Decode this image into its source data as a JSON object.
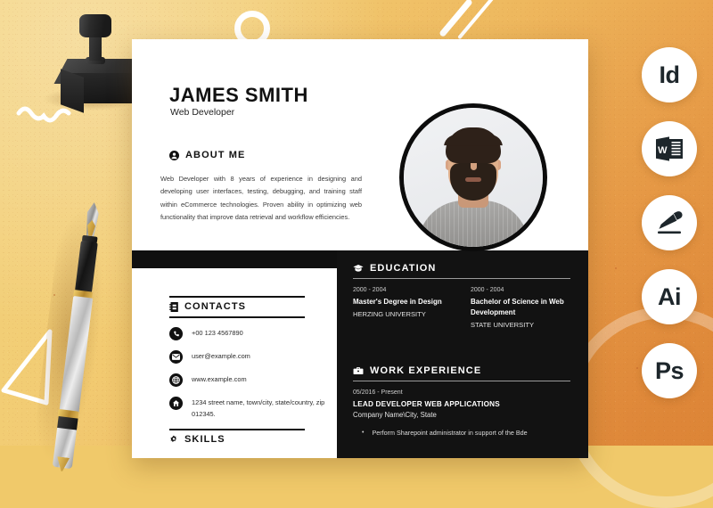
{
  "background": {
    "base_color": "#eeb85e",
    "page_color": "#ffffff",
    "accent_dark": "#101010"
  },
  "decor": {
    "stamp": "rubber-stamp",
    "pen": "fountain-pen",
    "ring": "white-ring-circle",
    "stripes": "white-diagonal-stripes",
    "squiggle": "white-squiggle",
    "triangle": "white-triangle-outline",
    "arc": "white-corner-arc"
  },
  "resume": {
    "name": "JAMES SMITH",
    "role": "Web Developer",
    "photo_alt": "portrait-photo",
    "about": {
      "icon": "user-icon",
      "title": "ABOUT ME",
      "text": "Web Developer with 8 years of experience in designing and developing user interfaces, testing, debugging, and training staff within eCommerce technologies. Proven ability in optimizing web functionality that improve data retrieval and workflow efficiencies."
    },
    "contacts": {
      "icon": "address-book-icon",
      "title": "CONTACTS",
      "items": [
        {
          "icon": "phone-icon",
          "text": "+00 123 4567890"
        },
        {
          "icon": "email-icon",
          "text": "user@example.com"
        },
        {
          "icon": "globe-icon",
          "text": "www.example.com"
        },
        {
          "icon": "home-icon",
          "text": "1234 street name, town/city, state/country, zip 012345."
        }
      ]
    },
    "skills": {
      "icon": "gear-icon",
      "title": "SKILLS"
    },
    "education": {
      "icon": "graduation-cap-icon",
      "title": "EDUCATION",
      "entries": [
        {
          "dates": "2000 - 2004",
          "degree": "Master's Degree in Design",
          "school": "HERZING UNIVERSITY"
        },
        {
          "dates": "2000 - 2004",
          "degree": "Bachelor of Science in Web Development",
          "school": "STATE UNIVERSITY"
        }
      ]
    },
    "work": {
      "icon": "briefcase-icon",
      "title": "WORK EXPERIENCE",
      "dates": "05/2016 - Present",
      "job_title": "LEAD DEVELOPER WEB APPLICATIONS",
      "company": "Company Name\\City, State",
      "bullet_marker": "•",
      "bullets": [
        "Perform Sharepoint administrator in support of the Bde"
      ]
    }
  },
  "badges": [
    {
      "id": "indesign",
      "label": "Id",
      "icon": "indesign-icon"
    },
    {
      "id": "word",
      "label": "W",
      "icon": "microsoft-word-icon"
    },
    {
      "id": "pages",
      "label": "",
      "icon": "pen-nib-icon"
    },
    {
      "id": "illustrator",
      "label": "Ai",
      "icon": "illustrator-icon"
    },
    {
      "id": "photoshop",
      "label": "Ps",
      "icon": "photoshop-icon"
    }
  ]
}
